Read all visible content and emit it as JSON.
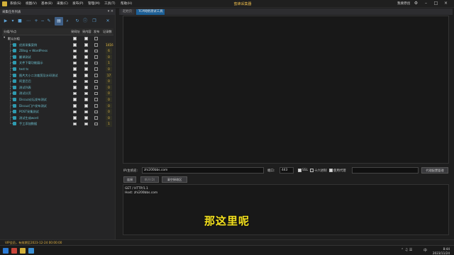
{
  "title_bar": {
    "menus": [
      "系统(S)",
      "视图(V)",
      "基本(B)",
      "采集(C)",
      "发布(P)",
      "管理(M)",
      "工具(T)",
      "帮助(H)"
    ],
    "app_title": "蜜蜂采集器",
    "user": "我要原创"
  },
  "left_panel": {
    "title": "采集任务列表",
    "columns": {
      "name": "分组/节点",
      "collect_url": "采网址",
      "collect_content": "采内容",
      "publish": "发布",
      "count": "记录数"
    },
    "group": "默认分组",
    "rows": [
      {
        "label": "优质采集案例",
        "count": "1416",
        "c1": true,
        "c2": true,
        "c3": false
      },
      {
        "label": "ZBlog + WordPress",
        "count": "6",
        "c1": true,
        "c2": true,
        "c3": false
      },
      {
        "label": "翻译测试",
        "count": "0",
        "c1": true,
        "c2": true,
        "c3": false
      },
      {
        "label": "文件下载功能展示",
        "count": "1",
        "c1": true,
        "c2": true,
        "c3": false
      },
      {
        "label": "test ts",
        "count": "0",
        "c1": true,
        "c2": true,
        "c3": false
      },
      {
        "label": "图片大小二次裁剪及水印测试",
        "count": "17",
        "c1": true,
        "c2": true,
        "c3": false
      },
      {
        "label": "阿里巴巴",
        "count": "0",
        "c1": true,
        "c2": true,
        "c3": false
      },
      {
        "label": "测试列表",
        "count": "0",
        "c1": true,
        "c2": true,
        "c3": false
      },
      {
        "label": "测试分页",
        "count": "0",
        "c1": true,
        "c2": true,
        "c3": false
      },
      {
        "label": "Discuz论坛发布测试",
        "count": "0",
        "c1": true,
        "c2": true,
        "c3": false
      },
      {
        "label": "Discuz门户发布测试",
        "count": "0",
        "c1": true,
        "c2": true,
        "c3": false
      },
      {
        "label": "POST采集测试",
        "count": "0",
        "c1": true,
        "c2": true,
        "c3": false
      },
      {
        "label": "测试生成word",
        "count": "0",
        "c1": true,
        "c2": true,
        "c3": false
      },
      {
        "label": "手工添加数据",
        "count": "1",
        "c1": true,
        "c2": true,
        "c3": false
      }
    ]
  },
  "tabs": [
    "起始页",
    "TCP网络测试工具"
  ],
  "connection": {
    "host_label": "IP/主机名:",
    "host_value": "zhi200bbs.com",
    "port_label": "端口:",
    "port_value": "443",
    "ssl_label": "SSL",
    "hex_label": "十六进制",
    "proxy_label": "使用代理",
    "proxy_button": "代理配置管理"
  },
  "actions": {
    "send": "连接",
    "disconnect": "断开(D)",
    "clear": "清空接收区"
  },
  "request_lines": [
    "GET / HTTP/1.1",
    "Host: zhi200bbs.com"
  ],
  "subtitle": "那这里呢",
  "status": {
    "vip": "VIP会员，有效期至2023-12-24 00:00:00"
  },
  "clock": {
    "time": "8:44",
    "date": "2023/11/24"
  },
  "colors": {
    "accent": "#1d5f96",
    "count_text": "#e6b84a",
    "subtitle": "#f5e21f",
    "node_text": "#6dc0cf"
  }
}
